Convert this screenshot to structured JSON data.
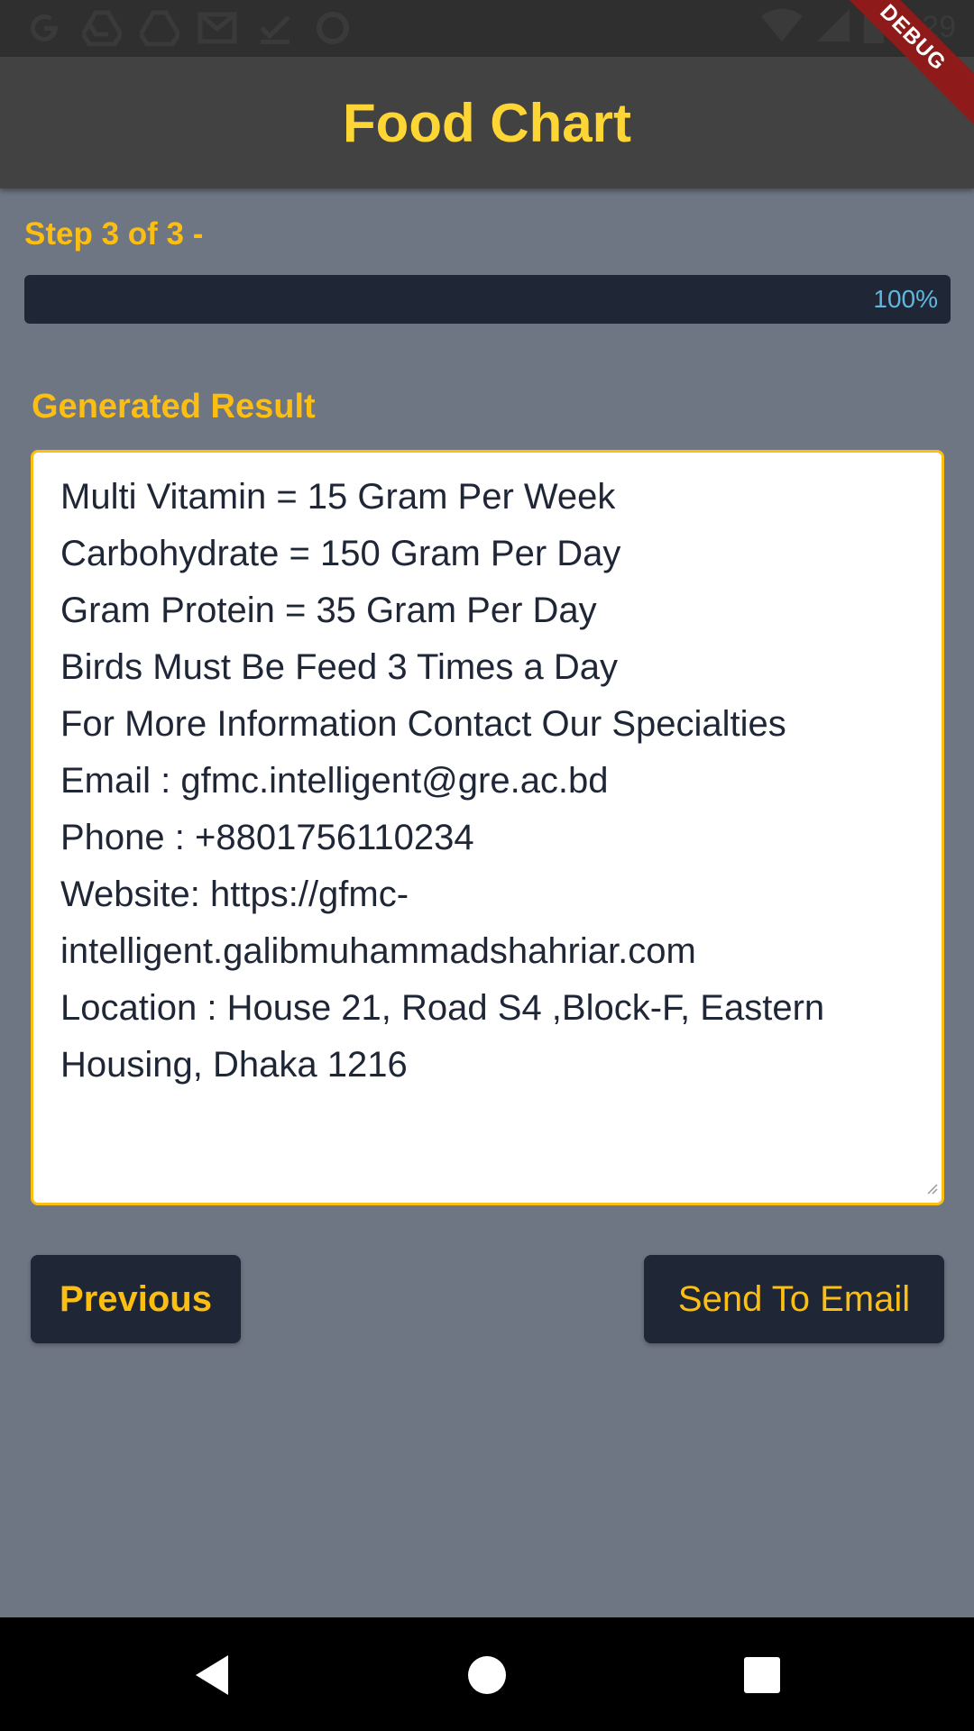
{
  "status_bar": {
    "time": "2:29",
    "left_icons": [
      "google-icon",
      "drive-icon",
      "drive-icon",
      "gmail-icon",
      "check-icon",
      "circle-icon"
    ],
    "right_icons": [
      "wifi-icon",
      "signal-icon",
      "battery-icon"
    ]
  },
  "debug_banner": "DEBUG",
  "app_bar": {
    "title": "Food Chart"
  },
  "step": {
    "label": "Step 3 of 3 -"
  },
  "progress": {
    "value": 1.0,
    "text": "100%"
  },
  "result": {
    "title": "Generated Result",
    "lines": [
      "Multi Vitamin = 15 Gram Per Week",
      "Carbohydrate = 150 Gram Per Day",
      "Gram Protein = 35 Gram Per Day",
      "Birds Must Be Feed 3 Times a Day",
      "For More Information Contact Our Specialties",
      "Email : gfmc.intelligent@gre.ac.bd",
      "Phone : +8801756110234",
      "Website: https://gfmc-",
      "intelligent.galibmuhammadshahriar.com",
      "Location : House 21, Road S4 ,Block-F, Eastern",
      "Housing, Dhaka 1216"
    ]
  },
  "buttons": {
    "previous": "Previous",
    "send_email": "Send To Email"
  },
  "nav_bar": {
    "icons": [
      "back-icon",
      "home-icon",
      "recents-icon"
    ]
  },
  "colors": {
    "accent": "#fcbe11",
    "title": "#fdd535",
    "background": "#6e7583",
    "dark": "#1f2636",
    "app_bar": "#424242",
    "progress_text": "#62b6e0"
  }
}
